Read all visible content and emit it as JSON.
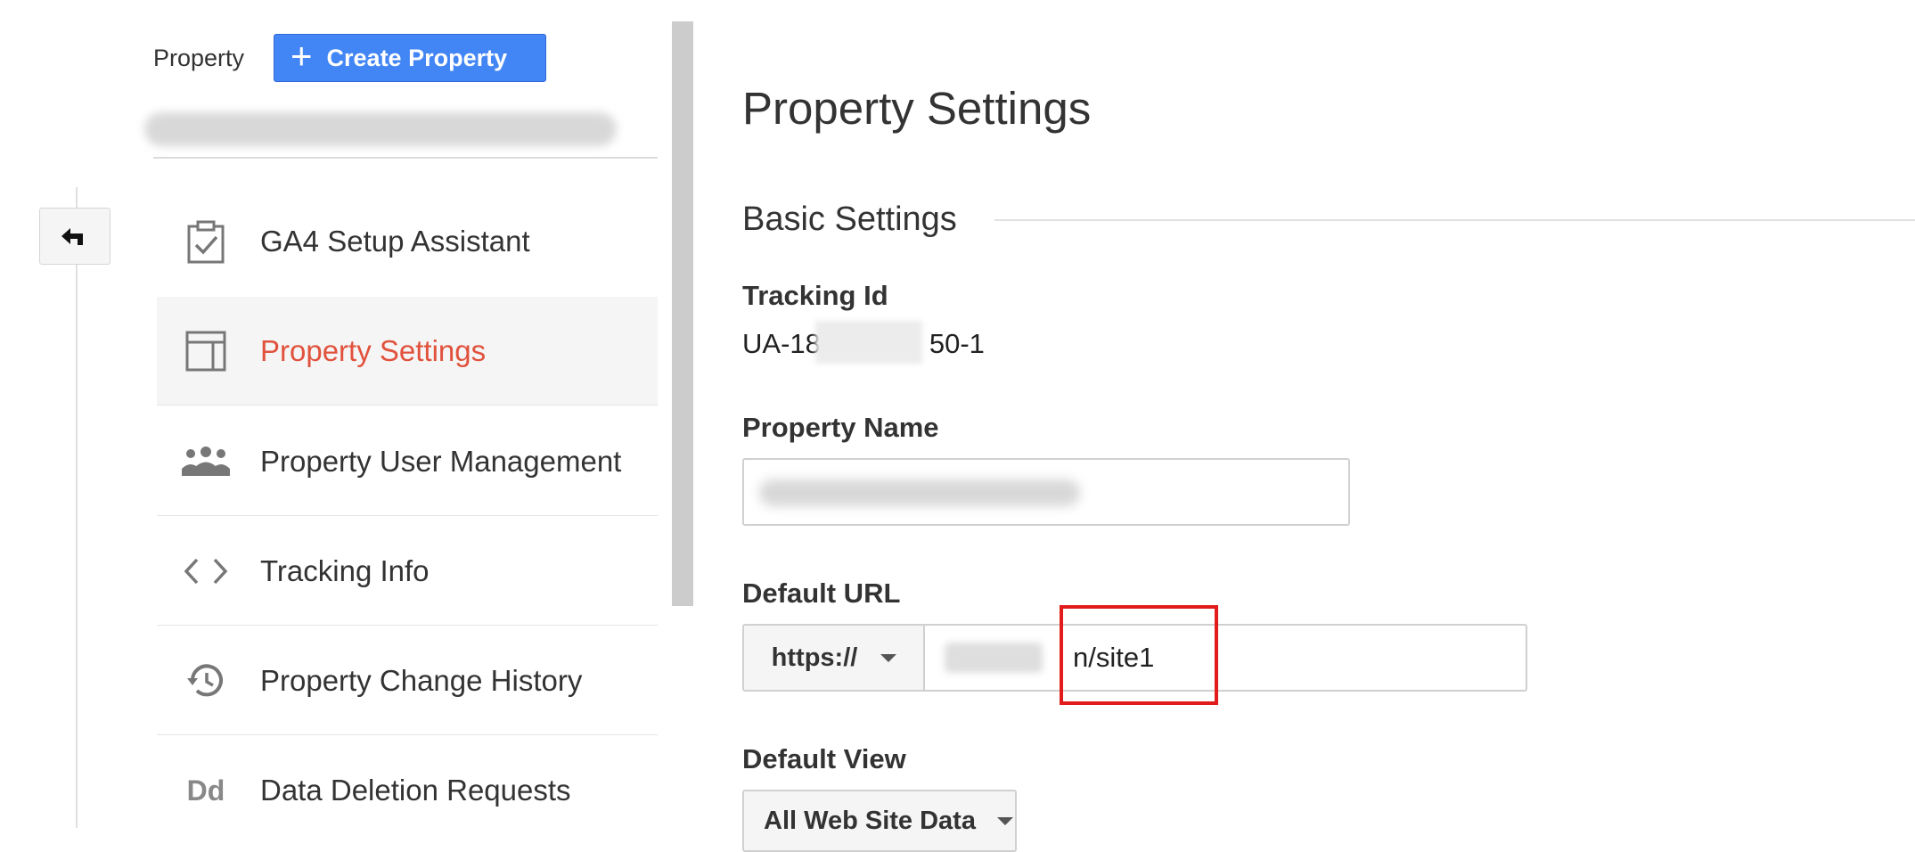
{
  "sidebar": {
    "property_label": "Property",
    "create_button": "Create Property",
    "items": [
      {
        "label": "GA4 Setup Assistant",
        "icon": "clipboard-check-icon",
        "active": false
      },
      {
        "label": "Property Settings",
        "icon": "layout-panel-icon",
        "active": true
      },
      {
        "label": "Property User Management",
        "icon": "people-icon",
        "active": false
      },
      {
        "label": "Tracking Info",
        "icon": "code-brackets-icon",
        "active": false
      },
      {
        "label": "Property Change History",
        "icon": "history-icon",
        "active": false
      },
      {
        "label": "Data Deletion Requests",
        "icon": "dd-letters-icon",
        "active": false
      }
    ],
    "dd_glyph": "Dd"
  },
  "main": {
    "title": "Property Settings",
    "section": "Basic Settings",
    "tracking_id_label": "Tracking Id",
    "tracking_id_prefix": "UA-18",
    "tracking_id_suffix": "50-1",
    "property_name_label": "Property Name",
    "default_url_label": "Default URL",
    "protocol": "https://",
    "url_suffix": "n/site1",
    "default_view_label": "Default View",
    "default_view_value": "All Web Site Data"
  },
  "colors": {
    "accent": "#4285f4",
    "active_nav": "#e1523d",
    "highlight": "#e21b1b"
  }
}
